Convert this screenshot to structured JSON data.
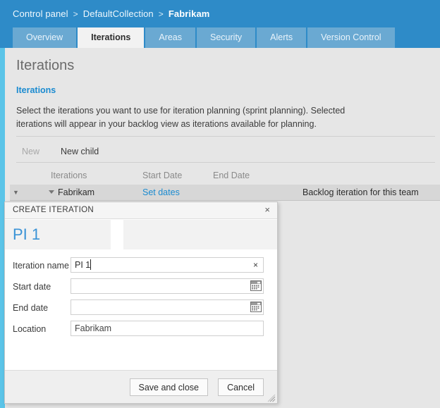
{
  "header": {
    "breadcrumb": {
      "items": [
        "Control panel",
        "DefaultCollection"
      ],
      "current": "Fabrikam",
      "separator": ">"
    },
    "tabs": [
      {
        "label": "Overview",
        "active": false
      },
      {
        "label": "Iterations",
        "active": true
      },
      {
        "label": "Areas",
        "active": false
      },
      {
        "label": "Security",
        "active": false
      },
      {
        "label": "Alerts",
        "active": false
      },
      {
        "label": "Version Control",
        "active": false
      }
    ]
  },
  "main": {
    "page_title": "Iterations",
    "section_title": "Iterations",
    "description": "Select the iterations you want to use for iteration planning (sprint planning). Selected iterations will appear in your backlog view as iterations available for planning.",
    "toolbar": {
      "new_label": "New",
      "new_child_label": "New child"
    },
    "grid": {
      "columns": [
        "Iterations",
        "Start Date",
        "End Date"
      ],
      "rows": [
        {
          "expander": "chevron-down-icon",
          "name": "Fabrikam",
          "start_date": "Set dates",
          "end_date": "",
          "note": "Backlog iteration for this team"
        }
      ]
    }
  },
  "dialog": {
    "title": "CREATE ITERATION",
    "close_label": "×",
    "heading": "PI 1",
    "fields": [
      {
        "label": "Iteration name",
        "value": "PI 1",
        "placeholder": "",
        "clear_label": "×",
        "type": "text-with-clear"
      },
      {
        "label": "Start date",
        "value": "",
        "placeholder": "",
        "type": "date"
      },
      {
        "label": "End date",
        "value": "",
        "placeholder": "",
        "type": "date"
      },
      {
        "label": "Location",
        "value": "Fabrikam",
        "placeholder": "",
        "type": "text"
      }
    ],
    "buttons": {
      "save": "Save and close",
      "cancel": "Cancel"
    }
  },
  "colors": {
    "header_blue": "#2e8bc8",
    "tab_blue": "#6aa9d2",
    "accent_cyan": "#5bc4e8",
    "link_blue": "#1b8bd0",
    "heading_blue": "#3a93d6",
    "page_bg": "#e6e6e6",
    "row_highlight": "#d7d7d7"
  }
}
